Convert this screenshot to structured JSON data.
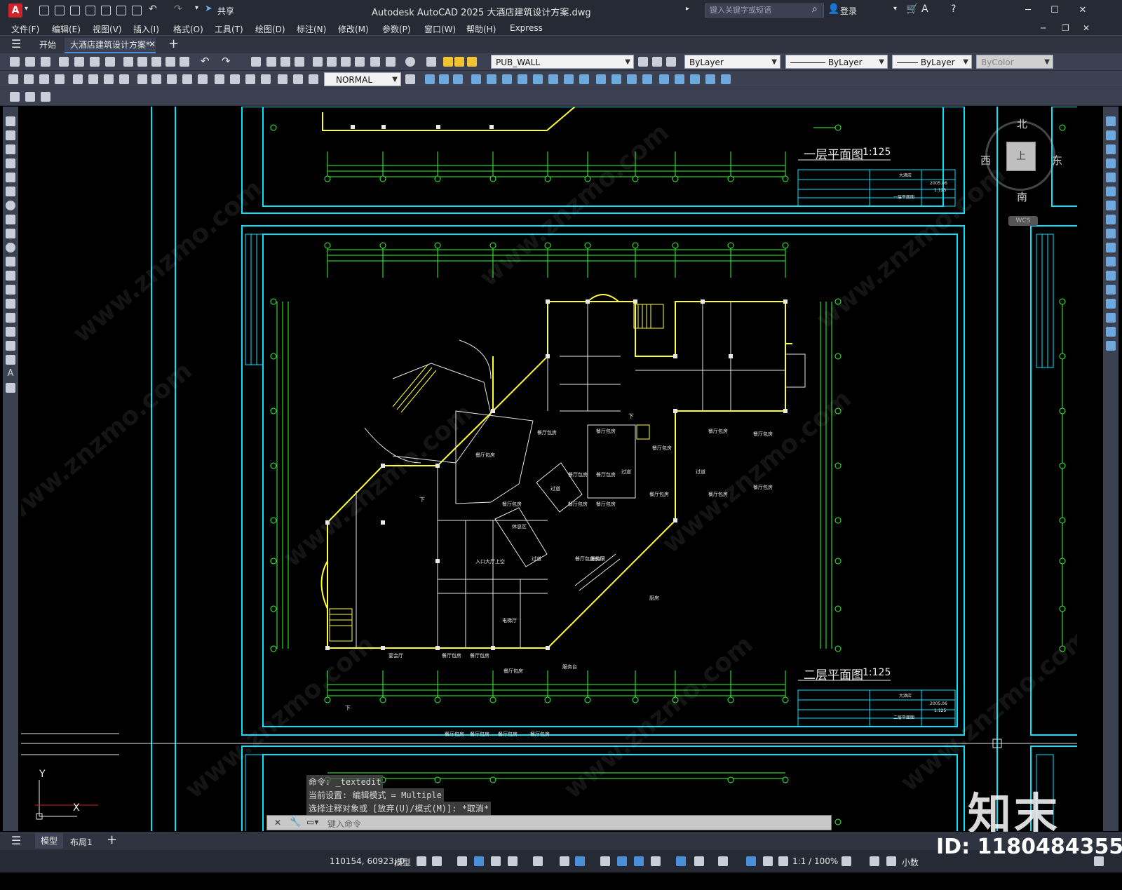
{
  "app": {
    "logo_letter": "A",
    "title": "Autodesk AutoCAD 2025    大酒店建筑设计方案.dwg",
    "share_label": "共享",
    "search_placeholder": "键入关键字或短语",
    "login_label": "登录",
    "win_min": "─",
    "win_max": "☐",
    "win_close": "✕"
  },
  "menu": [
    "文件(F)",
    "编辑(E)",
    "视图(V)",
    "插入(I)",
    "格式(O)",
    "工具(T)",
    "绘图(D)",
    "标注(N)",
    "修改(M)",
    "参数(P)",
    "窗口(W)",
    "帮助(H)",
    "Express"
  ],
  "tabs": {
    "start": "开始",
    "document": "大酒店建筑设计方案*",
    "close": "✕",
    "add": "+"
  },
  "toolbar": {
    "layer": "PUB_WALL",
    "color": "ByLayer",
    "linetype": "ByLayer",
    "lineweight": "ByLayer",
    "plotstyle": "ByColor",
    "dimstyle": "NORMAL"
  },
  "viewcube": {
    "north": "北",
    "south": "南",
    "east": "东",
    "west": "西",
    "face": "上",
    "wcs": "WCS"
  },
  "drawing": {
    "plan1_title": "一层平面图",
    "plan1_scale": "1:125",
    "plan2_title": "二层平面图",
    "plan2_scale": "1:125",
    "tb_hotel": "大酒店",
    "tb_date": "2005.06",
    "tb_scale": "1:125",
    "tb_plan1": "一层平面图",
    "tb_plan2": "二层平面图",
    "rooms": {
      "entrance": "入口大厅上空",
      "banquet": "宴会厅",
      "private": "餐厅包房",
      "corridor": "过道",
      "elevator": "电梯厅",
      "service": "服务台",
      "kitchen": "厨房",
      "stair_down": "下",
      "rest": "休息区",
      "service_room": "服务间",
      "private_front": "餐厅包房前厅"
    },
    "ucs_y": "Y",
    "ucs_x": "X"
  },
  "command": {
    "line1": "命令: _textedit",
    "line2": "当前设置: 编辑模式 = Multiple",
    "line3": "选择注释对象或 [放弃(U)/模式(M)]: *取消*",
    "placeholder": "键入命令"
  },
  "layout_tabs": {
    "model": "模型",
    "layout1": "布局1",
    "add": "+"
  },
  "status": {
    "coords": "110154, 60923, 0",
    "model": "模型",
    "scale": "1:1 / 100%",
    "units": "小数"
  },
  "watermark": {
    "brand": "知末",
    "id": "ID: 1180484355",
    "site": "www.znzmo.com"
  },
  "colors": {
    "cad_cyan": "#00e5ff",
    "cad_green": "#33ff33",
    "cad_yellow": "#ffff33",
    "cad_white": "#e8e8e8",
    "brand_red": "#d2232a"
  }
}
